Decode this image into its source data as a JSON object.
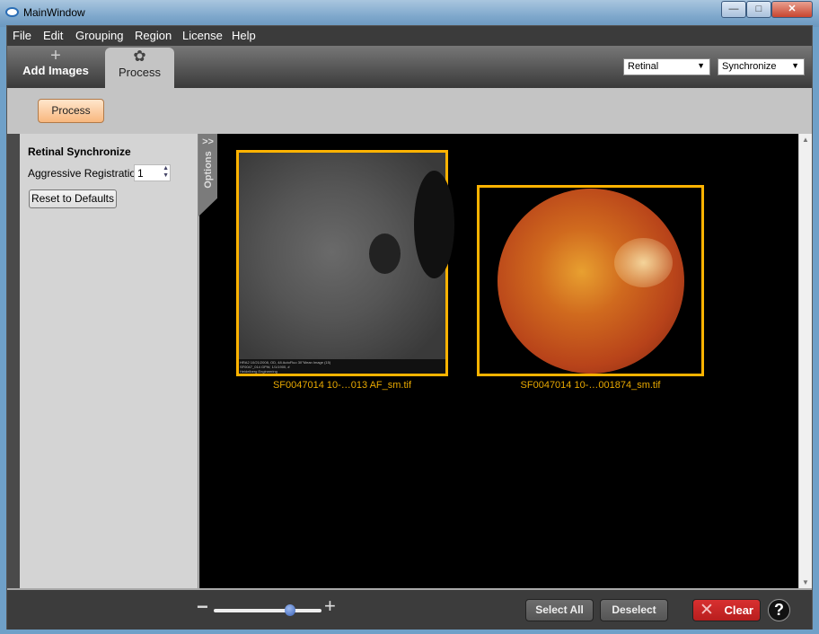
{
  "window": {
    "title": "MainWindow",
    "minimize": "—",
    "maximize": "□",
    "close": "✕"
  },
  "menu": [
    "File",
    "Edit",
    "Grouping",
    "Region",
    "License",
    "Help"
  ],
  "tabs": [
    {
      "label": "Add Images",
      "icon": "plus-icon"
    },
    {
      "label": "Process",
      "icon": "gear-icon",
      "active": true
    }
  ],
  "selectors": {
    "mode": "Retinal",
    "action": "Synchronize"
  },
  "toolbar": {
    "process": "Process"
  },
  "options": {
    "tab_label": "Options",
    "toggle": ">>",
    "title": "Retinal Synchronize",
    "aggressive_label": "Aggressive Registration:",
    "aggressive_value": "1",
    "reset": "Reset to Defaults"
  },
  "images": [
    {
      "caption": "SF0047014 10-…013 AF_sm.tif",
      "overlay": [
        "HRA2 10/21/2008, OD, 48 AutoFluo 30°Mean Image (15)",
        "SF0047_014 GPW, 1/1/1900, #",
        "Heidelberg Engineering"
      ],
      "selected": true
    },
    {
      "caption": "SF0047014 10-…001874_sm.tif",
      "selected": true
    }
  ],
  "selection_color": "#ffb300",
  "bottom": {
    "zoom_minus": "−",
    "zoom_plus": "+",
    "zoom_level": 0.71,
    "select_all": "Select All",
    "deselect": "Deselect",
    "clear": "Clear",
    "help": "?"
  }
}
